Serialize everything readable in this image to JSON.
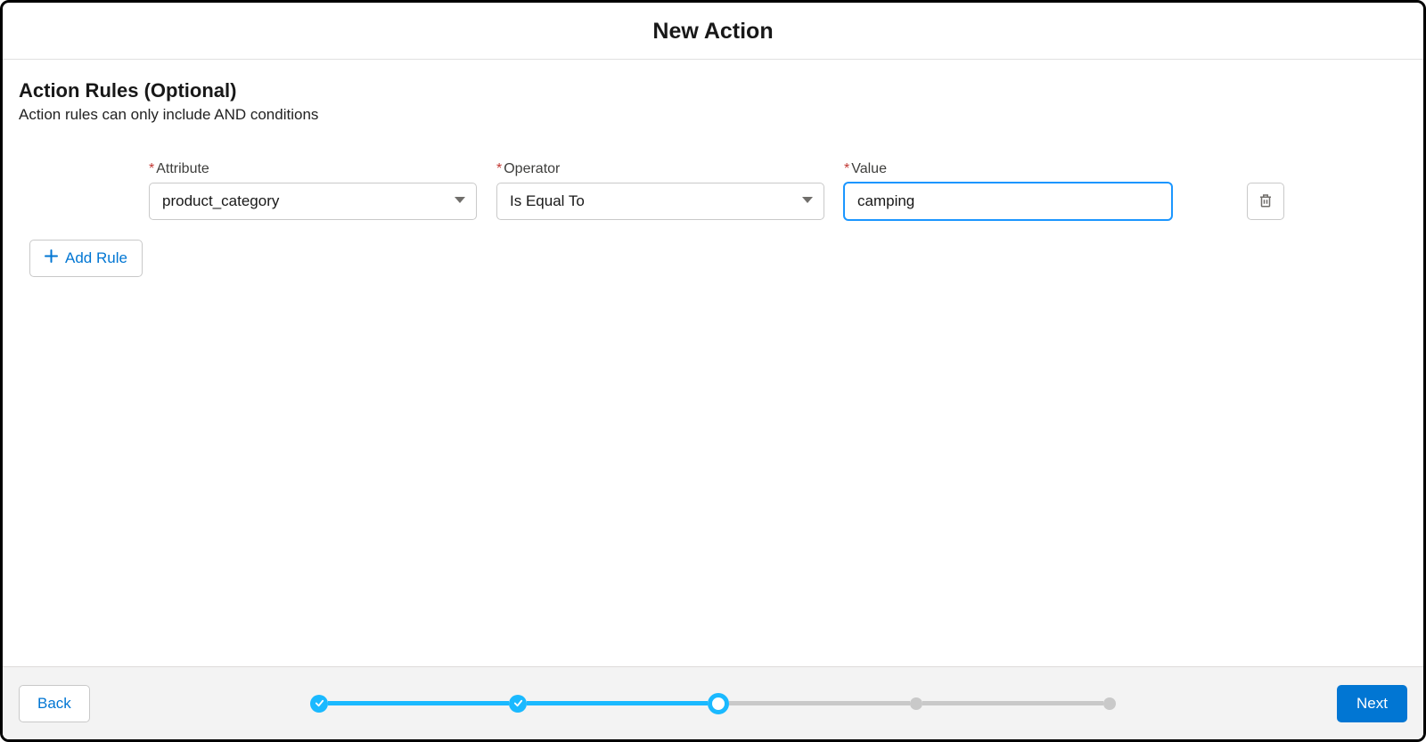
{
  "header": {
    "title": "New Action"
  },
  "section": {
    "title": "Action Rules (Optional)",
    "subtitle": "Action rules can only include AND conditions"
  },
  "rule": {
    "attribute_label": "Attribute",
    "attribute_value": "product_category",
    "operator_label": "Operator",
    "operator_value": "Is Equal To",
    "value_label": "Value",
    "value_value": "camping"
  },
  "buttons": {
    "add_rule": "Add Rule",
    "back": "Back",
    "next": "Next"
  },
  "progress": {
    "total_steps": 5,
    "current_step": 3
  }
}
